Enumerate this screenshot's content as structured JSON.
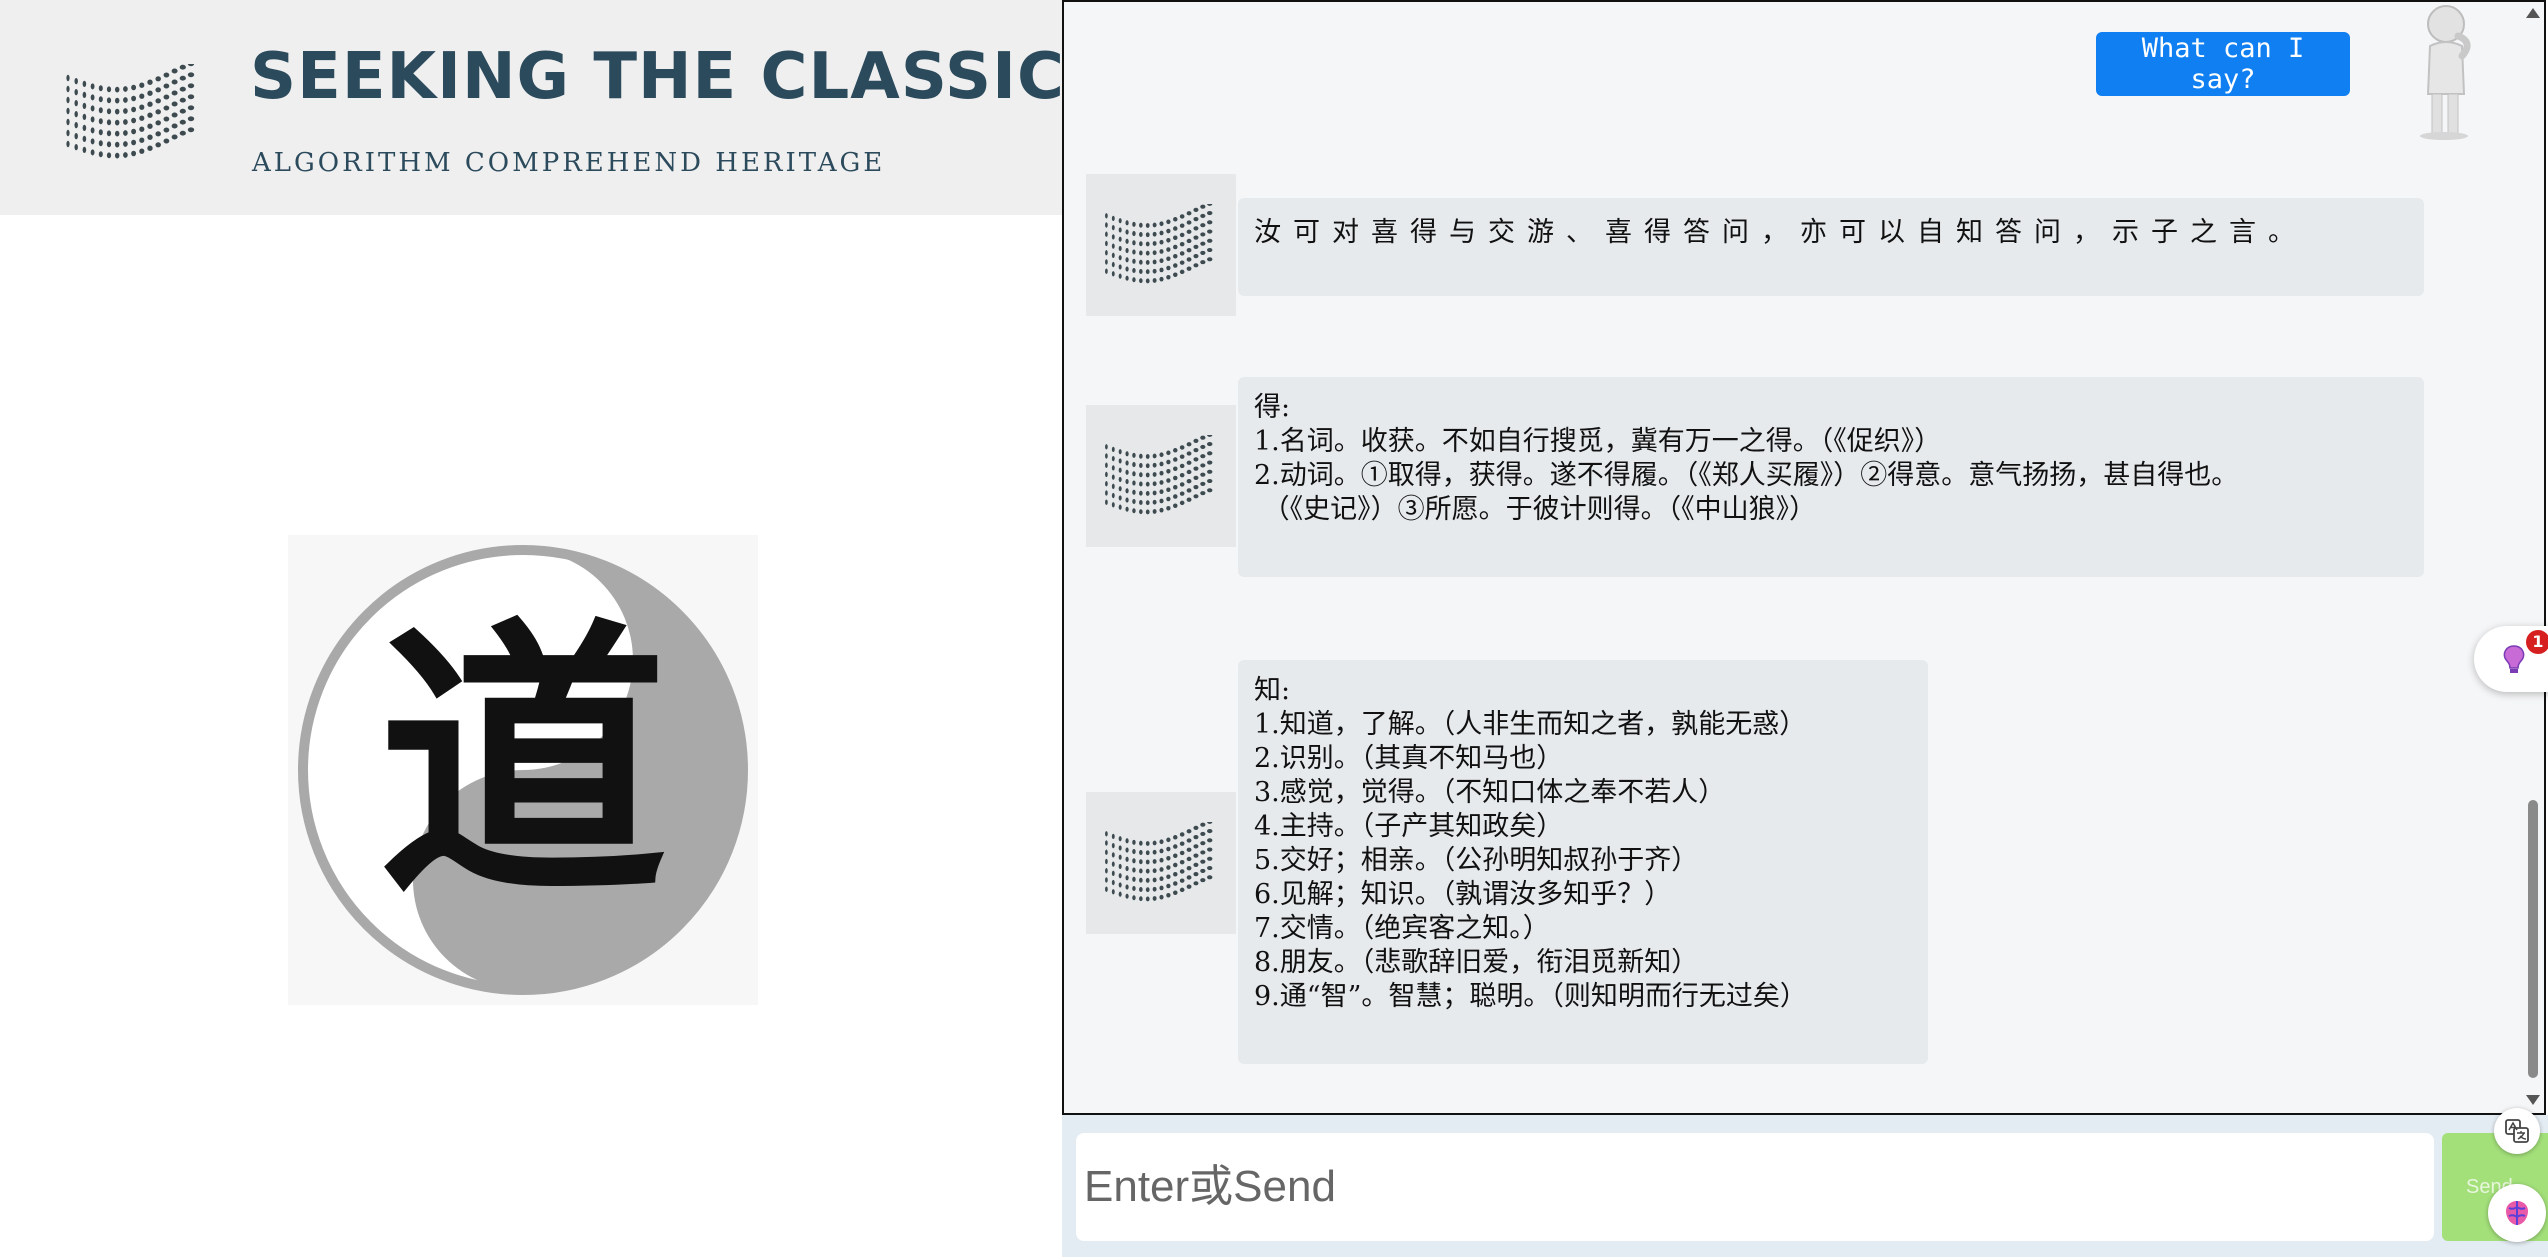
{
  "brand": {
    "title": "SEEKING THE CLASSICS",
    "subtitle": "ALGORITHM COMPREHEND   HERITAGE",
    "emblem_char": "道"
  },
  "chat": {
    "help_button_label": "What can I say?",
    "messages": [
      {
        "text": "汝可对喜得与交游、喜得答问，亦可以自知答问，示子之言。"
      },
      {
        "text": "得:\n1.名词。收获。不如自行搜觅，冀有万一之得。（《促织》）\n2.动词。①取得，获得。遂不得履。（《郑人买履》）②得意。意气扬扬，甚自得也。\n （《史记》）③所愿。于彼计则得。（《中山狼》）"
      },
      {
        "text": "知:\n1.知道，了解。（人非生而知之者，孰能无惑）\n2.识别。（其真不知马也）\n3.感觉，觉得。（不知口体之奉不若人）\n4.主持。（子产其知政矣）\n5.交好；相亲。（公孙明知叔孙于齐）\n6.见解；知识。（孰谓汝多知乎？）\n7.交情。（绝宾客之知。）\n8.朋友。（悲歌辞旧爱，衔泪觅新知）\n9.通“智”。智慧；聪明。（则知明而行无过矣）"
      }
    ]
  },
  "input": {
    "placeholder": "Enter或Send",
    "value": "",
    "send_label": "Send"
  },
  "widgets": {
    "extension_badge_count": "1"
  },
  "colors": {
    "brand_text": "#2b4a5c",
    "help_button": "#0f7ff2",
    "send_button": "#a3e07a",
    "bubble_bg": "#e7eaed",
    "chat_bg": "#f5f6f7"
  }
}
